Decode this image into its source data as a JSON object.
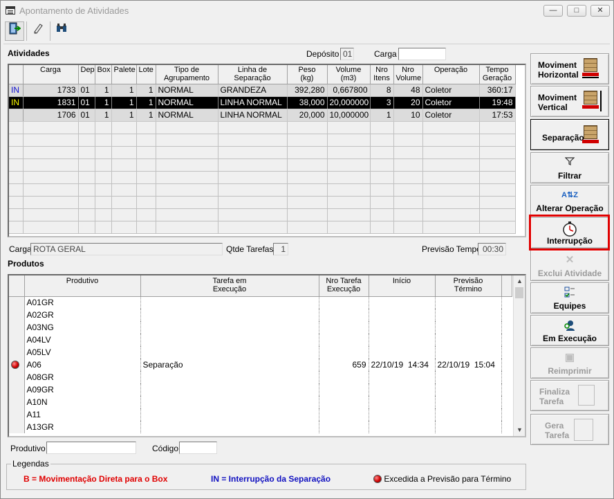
{
  "window": {
    "title": "Apontamento de Atividades"
  },
  "toolbar": {
    "exit_icon": "exit-door-icon",
    "eraser_icon": "eraser-icon",
    "search_icon": "binoculars-icon"
  },
  "atividades": {
    "label": "Atividades",
    "deposito_label": "Depósito",
    "deposito_value": "01",
    "carga_label": "Carga",
    "carga_value": "",
    "columns": [
      "",
      "Carga",
      "Dep",
      "Box",
      "Palete",
      "Lote",
      "Tipo de\nAgrupamento",
      "Linha de\nSeparação",
      "Peso\n(kg)",
      "Volume\n(m3)",
      "Nro\nItens",
      "Nro\nVolume",
      "Operação",
      "Tempo\nGeração"
    ],
    "rows": [
      [
        "IN",
        "1733",
        "01",
        "1",
        "1",
        "1",
        "NORMAL",
        "GRANDEZA",
        "392,280",
        "0,667800",
        "8",
        "48",
        "Coletor",
        "360:17"
      ],
      [
        "IN",
        "1831",
        "01",
        "1",
        "1",
        "1",
        "NORMAL",
        "LINHA NORMAL",
        "38,000",
        "20,000000",
        "3",
        "20",
        "Coletor",
        "19:48"
      ],
      [
        "",
        "1706",
        "01",
        "1",
        "1",
        "1",
        "NORMAL",
        "LINHA NORMAL",
        "20,000",
        "10,000000",
        "1",
        "10",
        "Coletor",
        "17:53"
      ]
    ]
  },
  "detail": {
    "carga_label": "Carga",
    "carga_value": "ROTA GERAL",
    "qtde_label": "Qtde Tarefas",
    "qtde_value": "1",
    "previsao_label": "Previsão Tempo",
    "previsao_value": "00:30"
  },
  "produtos": {
    "label": "Produtos",
    "columns": [
      "",
      "Produtivo",
      "Tarefa em\nExecução",
      "Nro Tarefa\nExecução",
      "Início",
      "Previsão\nTérmino"
    ],
    "rows": [
      [
        "",
        "A01GR",
        "",
        "",
        "",
        ""
      ],
      [
        "",
        "A02GR",
        "",
        "",
        "",
        ""
      ],
      [
        "",
        "A03NG",
        "",
        "",
        "",
        ""
      ],
      [
        "",
        "A04LV",
        "",
        "",
        "",
        ""
      ],
      [
        "",
        "A05LV",
        "",
        "",
        "",
        ""
      ],
      [
        "red-ball-icon",
        "A06",
        "Separação",
        "659",
        "22/10/19  14:34",
        "22/10/19  15:04"
      ],
      [
        "",
        "A08GR",
        "",
        "",
        "",
        ""
      ],
      [
        "",
        "A09GR",
        "",
        "",
        "",
        ""
      ],
      [
        "",
        "A10N",
        "",
        "",
        "",
        ""
      ],
      [
        "",
        "A11",
        "",
        "",
        "",
        ""
      ],
      [
        "",
        "A13GR",
        "",
        "",
        "",
        ""
      ]
    ]
  },
  "filters": {
    "produtivo_label": "Produtivo",
    "produtivo_value": "",
    "codigo_label": "Código",
    "codigo_value": ""
  },
  "legend": {
    "title": "Legendas",
    "b_letter": "B",
    "b_text": "= Movimentação Direta para o Box",
    "in_text": "IN = Interrupção da Separação",
    "red_text": "Excedida a Previsão para Término",
    "colors": {
      "b": "#e00000",
      "in": "#1010c0"
    }
  },
  "side_buttons": {
    "mov_horizontal": "Moviment\nHorizontal",
    "mov_vertical": "Moviment\nVertical",
    "separacao": "Separação",
    "filtrar": "Filtrar",
    "alterar_operacao": "Alterar Operação",
    "interrupcao": "Interrupção",
    "exclui_atividade": "Exclui Atividade",
    "equipes": "Equipes",
    "em_execucao": "Em Execução",
    "reimprimir": "Reimprimir",
    "finaliza_tarefa": "Finaliza\nTarefa",
    "gera_tarefa": "Gera\nTarefa"
  }
}
